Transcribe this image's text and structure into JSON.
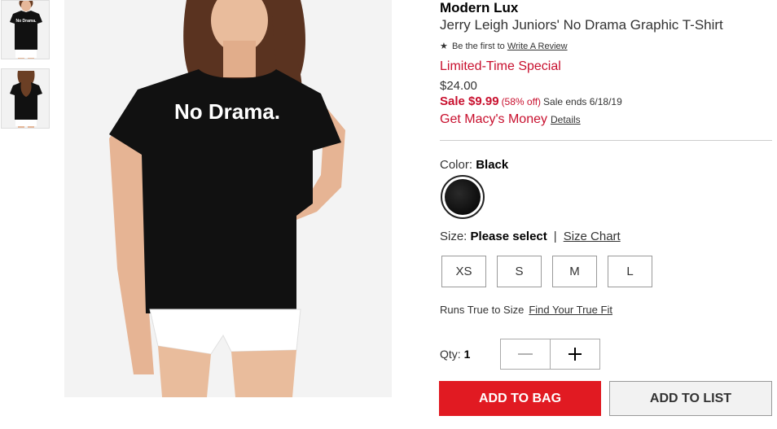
{
  "gallery": {
    "thumbnails": [
      {
        "icon": "front-view-thumbnail",
        "shirt_text": "No Drama."
      },
      {
        "icon": "back-view-thumbnail"
      }
    ],
    "main_image": {
      "icon": "model-wearing-shirt-photo",
      "shirt_text": "No Drama."
    }
  },
  "product": {
    "brand": "Modern Lux",
    "name": "Jerry Leigh Juniors' No Drama Graphic T-Shirt",
    "review_prefix": "Be the first to",
    "review_link": "Write A Review",
    "promo": "Limited-Time Special",
    "original_price": "$24.00",
    "sale_price": "Sale $9.99",
    "sale_percent": "(58% off)",
    "sale_ends": "Sale ends 6/18/19",
    "money_label": "Get Macy's Money",
    "details_link": "Details"
  },
  "color": {
    "label": "Color:",
    "selected": "Black",
    "swatch_hex": "#000000"
  },
  "size": {
    "label": "Size:",
    "selected": "Please select",
    "separator": "|",
    "chart_link": "Size Chart",
    "options": [
      "XS",
      "S",
      "M",
      "L"
    ]
  },
  "fit": {
    "label": "Runs True to Size",
    "link": "Find Your True Fit"
  },
  "quantity": {
    "label": "Qty:",
    "value": "1"
  },
  "actions": {
    "add_to_bag": "ADD TO BAG",
    "add_to_list": "ADD TO LIST",
    "brand_red": "#e11a22"
  }
}
